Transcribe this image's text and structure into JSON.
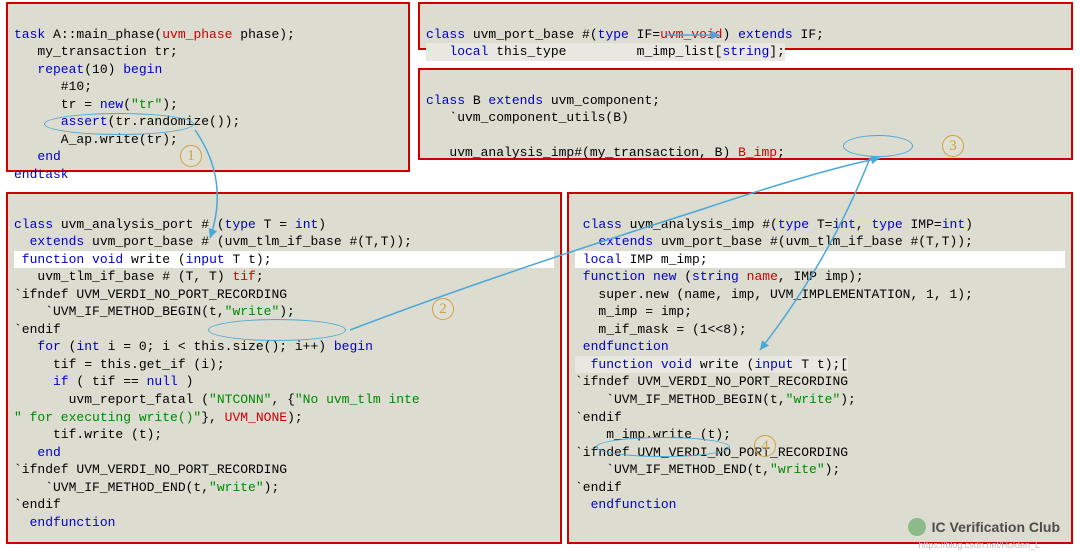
{
  "box1": {
    "l1_a": "task",
    "l1_b": " A::main_phase(",
    "l1_c": "uvm_phase",
    "l1_d": " phase);",
    "l2": "   my_transaction tr;",
    "l3_a": "   repeat",
    "l3_b": "(10) ",
    "l3_c": "begin",
    "l4": "      #10;",
    "l5_a": "      tr = ",
    "l5_b": "new",
    "l5_c": "(",
    "l5_d": "\"tr\"",
    "l5_e": ");",
    "l6_a": "      ",
    "l6_b": "assert",
    "l6_c": "(tr.randomize());",
    "l7": "      A_ap.write(tr);",
    "l8": "   end",
    "l9": "endtask"
  },
  "box2": {
    "l1_a": "class",
    "l1_b": " uvm_port_base #(",
    "l1_c": "type",
    "l1_d": " IF=",
    "l1_e": "uvm_void",
    "l1_f": ") ",
    "l1_g": "extends",
    "l1_h": " IF;",
    "l2_a": "   local",
    "l2_b": " this_type         m_imp_list[",
    "l2_c": "string",
    "l2_d": "];"
  },
  "box3": {
    "l1_a": "class",
    "l1_b": " B ",
    "l1_c": "extends",
    "l1_d": " uvm_component;",
    "l2": "   `uvm_component_utils(B)",
    "l3": "",
    "l4_a": "   uvm_analysis_imp#(my_transaction, B) ",
    "l4_b": "B_imp",
    "l4_c": ";"
  },
  "box4": {
    "l1_a": "class",
    "l1_b": " uvm_analysis_port # (",
    "l1_c": "type",
    "l1_d": " T = ",
    "l1_e": "int",
    "l1_f": ")",
    "l2_a": "  extends",
    "l2_b": " uvm_port_base # (uvm_tlm_if_base #(T,T));",
    "l3_a": " function",
    "l3_b": " ",
    "l3_c": "void",
    "l3_d": " write (",
    "l3_e": "input",
    "l3_f": " T t);",
    "l4_a": "   uvm_tlm_if_base # (T, T) ",
    "l4_b": "tif",
    "l4_c": ";",
    "l5": "`ifndef UVM_VERDI_NO_PORT_RECORDING",
    "l6_a": "    `UVM_IF_METHOD_BEGIN(t,",
    "l6_b": "\"write\"",
    "l6_c": ");",
    "l7": "`endif",
    "l8_a": "   for",
    "l8_b": " (",
    "l8_c": "int",
    "l8_d": " i = 0; i < this.size(); i++) ",
    "l8_e": "begin",
    "l9": "     tif = this.get_if (i);",
    "l10_a": "     if",
    "l10_b": " ( tif == ",
    "l10_c": "null",
    "l10_d": " )",
    "l11_a": "       uvm_report_fatal (",
    "l11_b": "\"NTCONN\"",
    "l11_c": ", {",
    "l11_d": "\"No uvm_tlm inte",
    "l11_e": "",
    "l12_a": "\" for executing write()\"",
    "l12_b": "}, ",
    "l12_c": "UVM_NONE",
    "l12_d": ");",
    "l13": "     tif.write (t);",
    "l14": "   end",
    "l15": "`ifndef UVM_VERDI_NO_PORT_RECORDING",
    "l16_a": "    `UVM_IF_METHOD_END(t,",
    "l16_b": "\"write\"",
    "l16_c": ");",
    "l17": "`endif",
    "l18": "  endfunction"
  },
  "box5": {
    "l1_a": " class",
    "l1_b": " uvm_analysis_imp #(",
    "l1_c": "type",
    "l1_d": " T=",
    "l1_e": "int",
    "l1_f": ", ",
    "l1_g": "type",
    "l1_h": " IMP=",
    "l1_i": "int",
    "l1_j": ")",
    "l2_a": "   extends",
    "l2_b": " uvm_port_base #(uvm_tlm_if_base #(T,T));",
    "l3_a": " local",
    "l3_b": " IMP m_imp;",
    "l4_a": " function",
    "l4_b": " ",
    "l4_c": "new",
    "l4_d": " (",
    "l4_e": "string",
    "l4_f": " ",
    "l4_g": "name",
    "l4_h": ", IMP imp);",
    "l5_a": "   super.new (name, imp, UVM_IMPLEMENTATION, 1, 1);",
    "l6": "   m_imp = imp;",
    "l7": "   m_if_mask = (1<<8);",
    "l8": " endfunction",
    "l9_a": "  function",
    "l9_b": " ",
    "l9_c": "void",
    "l9_d": " write (",
    "l9_e": "input",
    "l9_f": " T t);[",
    "l10": "`ifndef UVM_VERDI_NO_PORT_RECORDING",
    "l11_a": "    `UVM_IF_METHOD_BEGIN(t,",
    "l11_b": "\"write\"",
    "l11_c": ");",
    "l12": "`endif",
    "l13": "    m_imp.write (t);",
    "l14": "`ifndef UVM_VERDI_NO_PORT_RECORDING",
    "l15_a": "    `UVM_IF_METHOD_END(t,",
    "l15_b": "\"write\"",
    "l15_c": ");",
    "l16": "`endif",
    "l17": "  endfunction"
  },
  "nums": {
    "n1": "1",
    "n2": "2",
    "n3": "3",
    "n4": "4"
  },
  "watermark": "IC Verification Club",
  "footnote": "https://blog.csdn.net/Holden_L"
}
